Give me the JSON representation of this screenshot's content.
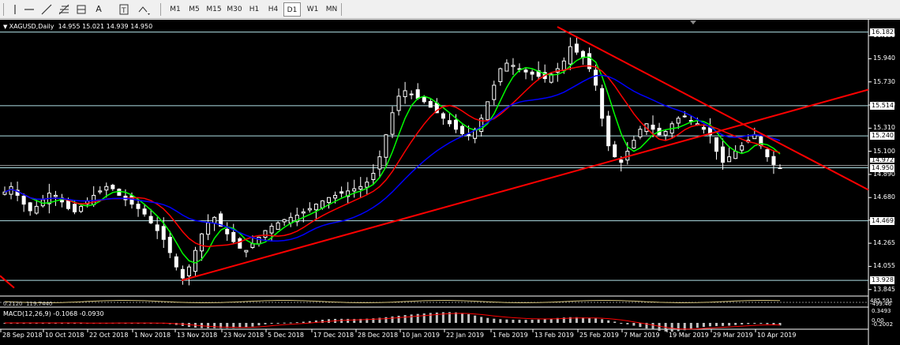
{
  "toolbar": {
    "tools": [
      "cursor",
      "crosshair",
      "vertical-line",
      "horizontal-line",
      "trendline",
      "fibonacci",
      "text",
      "label",
      "arrows"
    ],
    "text_tool": "A",
    "timeframes": [
      "M1",
      "M5",
      "M15",
      "M30",
      "H1",
      "H4",
      "D1",
      "W1",
      "MN"
    ],
    "active_timeframe": "D1"
  },
  "chart": {
    "symbol_line": "XAGUSD,Daily  14.955 15.021 14.939 14.950",
    "macd_label": "MACD(12,26,9) -0.1068 -0.0930",
    "sub_label": "0.2120  119.7440",
    "price_ticks": [
      "16.150",
      "15.940",
      "15.730",
      "15.520",
      "15.310",
      "15.100",
      "14.890",
      "14.680",
      "14.475",
      "14.265",
      "14.055",
      "13.845"
    ],
    "price_boxes": [
      "16.182",
      "15.514",
      "15.240",
      "14.950",
      "14.469",
      "13.928"
    ],
    "price_box_partial": "14.972",
    "macd_ticks": [
      "0.3493",
      "0.00",
      "-0.2002"
    ],
    "sub_ticks": [
      "485.591",
      "-499.46"
    ],
    "date_labels": [
      "28 Sep 2018",
      "10 Oct 2018",
      "22 Oct 2018",
      "1 Nov 2018",
      "13 Nov 2018",
      "23 Nov 2018",
      "5 Dec 2018",
      "17 Dec 2018",
      "28 Dec 2018",
      "10 Jan 2019",
      "22 Jan 2019",
      "1 Feb 2019",
      "13 Feb 2019",
      "25 Feb 2019",
      "7 Mar 2019",
      "19 Mar 2019",
      "29 Mar 2019",
      "10 Apr 2019"
    ],
    "colors": {
      "background": "#000000",
      "candle": "#ffffff",
      "ma_fast": "#00ff00",
      "ma_mid": "#ff0000",
      "ma_slow": "#0000ff",
      "trendline": "#ff0000",
      "level_line": "#b0e0e6",
      "macd_hist": "#c0c0c0",
      "macd_signal": "#ff0000"
    },
    "close_series": [
      14.73,
      14.78,
      14.7,
      14.62,
      14.56,
      14.6,
      14.66,
      14.72,
      14.7,
      14.64,
      14.58,
      14.55,
      14.6,
      14.65,
      14.7,
      14.74,
      14.78,
      14.76,
      14.7,
      14.66,
      14.62,
      14.58,
      14.53,
      14.45,
      14.38,
      14.3,
      14.18,
      14.05,
      13.95,
      14.05,
      14.2,
      14.35,
      14.45,
      14.5,
      14.42,
      14.35,
      14.28,
      14.22,
      14.2,
      14.26,
      14.32,
      14.38,
      14.42,
      14.45,
      14.48,
      14.5,
      14.52,
      14.55,
      14.58,
      14.62,
      14.65,
      14.68,
      14.7,
      14.72,
      14.74,
      14.76,
      14.78,
      14.82,
      14.9,
      15.05,
      15.25,
      15.45,
      15.6,
      15.65,
      15.62,
      15.58,
      15.55,
      15.5,
      15.45,
      15.4,
      15.35,
      15.3,
      15.26,
      15.25,
      15.3,
      15.4,
      15.55,
      15.7,
      15.85,
      15.9,
      15.88,
      15.85,
      15.82,
      15.8,
      15.78,
      15.76,
      15.8,
      15.85,
      15.92,
      16.05,
      16.0,
      15.95,
      15.85,
      15.7,
      15.4,
      15.15,
      15.05,
      15.0,
      15.1,
      15.2,
      15.3,
      15.35,
      15.3,
      15.25,
      15.28,
      15.35,
      15.4,
      15.42,
      15.38,
      15.35,
      15.3,
      15.25,
      15.1,
      15.0,
      15.05,
      15.1,
      15.15,
      15.2,
      15.25,
      15.15,
      15.05,
      14.98,
      14.95
    ]
  }
}
